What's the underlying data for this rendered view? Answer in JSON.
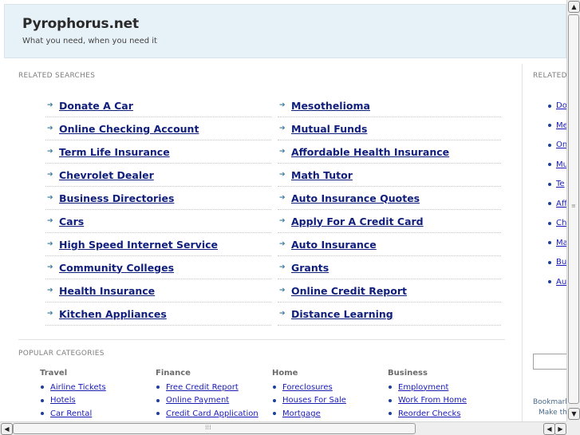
{
  "header": {
    "site_title": "Pyrophorus.net",
    "tagline": "What you need, when you need it"
  },
  "related": {
    "title": "RELATED SEARCHES",
    "left": [
      "Donate A Car",
      "Online Checking Account",
      "Term Life Insurance",
      "Chevrolet Dealer",
      "Business Directories",
      "Cars",
      "High Speed Internet Service",
      "Community Colleges",
      "Health Insurance",
      "Kitchen Appliances"
    ],
    "right": [
      "Mesothelioma",
      "Mutual Funds",
      "Affordable Health Insurance",
      "Math Tutor",
      "Auto Insurance Quotes",
      "Apply For A Credit Card",
      "Auto Insurance",
      "Grants",
      "Online Credit Report",
      "Distance Learning"
    ]
  },
  "popular": {
    "title": "POPULAR CATEGORIES",
    "columns": [
      {
        "head": "Travel",
        "items": [
          "Airline Tickets",
          "Hotels",
          "Car Rental"
        ]
      },
      {
        "head": "Finance",
        "items": [
          "Free Credit Report",
          "Online Payment",
          "Credit Card Application"
        ]
      },
      {
        "head": "Home",
        "items": [
          "Foreclosures",
          "Houses For Sale",
          "Mortgage"
        ]
      },
      {
        "head": "Business",
        "items": [
          "Employment",
          "Work From Home",
          "Reorder Checks"
        ]
      }
    ]
  },
  "side": {
    "title": "RELATED",
    "items": [
      "Do",
      "Me",
      "On",
      "Mu",
      "Te",
      "Aff",
      "Ch",
      "Ma",
      "Bu",
      "Aut"
    ],
    "bookmark": "Bookmark",
    "make_this": "Make thi"
  },
  "scrollbars": {
    "up": "▲",
    "down": "▼",
    "left": "◀",
    "right": "▶"
  }
}
